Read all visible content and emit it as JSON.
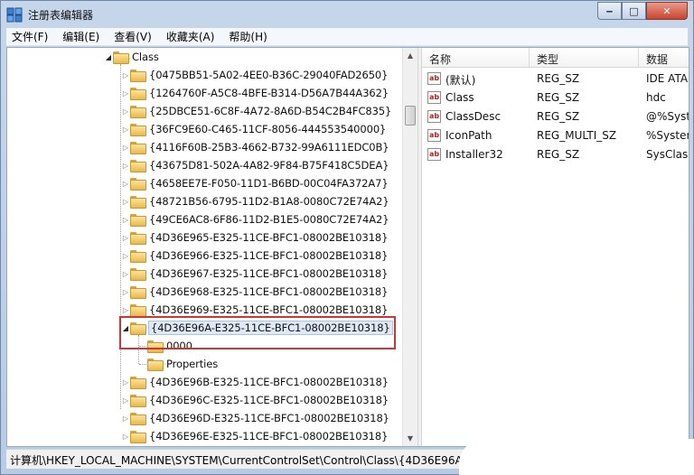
{
  "window": {
    "title": "注册表编辑器",
    "minimize": "‒",
    "maximize": "□",
    "close": "✕"
  },
  "menu": [
    "文件(F)",
    "编辑(E)",
    "查看(V)",
    "收藏夹(A)",
    "帮助(H)"
  ],
  "tree": {
    "root": "Class",
    "nodes": [
      "{0475BB51-5A02-4EE0-B36C-29040FAD2650}",
      "{1264760F-A5C8-4BFE-B314-D56A7B44A362}",
      "{25DBCE51-6C8F-4A72-8A6D-B54C2B4FC835}",
      "{36FC9E60-C465-11CF-8056-444553540000}",
      "{4116F60B-25B3-4662-B732-99A6111EDC0B}",
      "{43675D81-502A-4A82-9F84-B75F418C5DEA}",
      "{4658EE7E-F050-11D1-B6BD-00C04FA372A7}",
      "{48721B56-6795-11D2-B1A8-0080C72E74A2}",
      "{49CE6AC8-6F86-11D2-B1E5-0080C72E74A2}",
      "{4D36E965-E325-11CE-BFC1-08002BE10318}",
      "{4D36E966-E325-11CE-BFC1-08002BE10318}",
      "{4D36E967-E325-11CE-BFC1-08002BE10318}",
      "{4D36E968-E325-11CE-BFC1-08002BE10318}",
      "{4D36E969-E325-11CE-BFC1-08002BE10318}",
      "{4D36E96A-E325-11CE-BFC1-08002BE10318}"
    ],
    "children": [
      "0000",
      "Properties"
    ],
    "after": [
      "{4D36E96B-E325-11CE-BFC1-08002BE10318}",
      "{4D36E96C-E325-11CE-BFC1-08002BE10318}",
      "{4D36E96D-E325-11CE-BFC1-08002BE10318}",
      "{4D36E96E-E325-11CE-BFC1-08002BE10318}"
    ]
  },
  "list": {
    "headers": [
      "名称",
      "类型",
      "数据"
    ],
    "rows": [
      {
        "name": "(默认)",
        "type": "REG_SZ",
        "data": "IDE ATA"
      },
      {
        "name": "Class",
        "type": "REG_SZ",
        "data": "hdc"
      },
      {
        "name": "ClassDesc",
        "type": "REG_SZ",
        "data": "@%Syst"
      },
      {
        "name": "IconPath",
        "type": "REG_MULTI_SZ",
        "data": "%Syster"
      },
      {
        "name": "Installer32",
        "type": "REG_SZ",
        "data": "SysClass"
      }
    ],
    "icon_text": "ab"
  },
  "status": "计算机\\HKEY_LOCAL_MACHINE\\SYSTEM\\CurrentControlSet\\Control\\Class\\{4D36E96A-",
  "colors": {
    "highlight_box": "#d03535",
    "folder": "#e8b94a",
    "value_icon_text": "#c01e1e"
  }
}
